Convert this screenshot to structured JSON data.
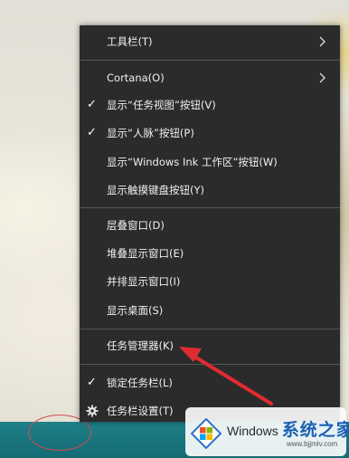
{
  "menu": {
    "items": [
      {
        "label": "工具栏(T)",
        "checked": false,
        "submenu": true
      },
      {
        "label": "Cortana(O)",
        "checked": false,
        "submenu": true
      },
      {
        "label": "显示“任务视图”按钮(V)",
        "checked": true,
        "submenu": false
      },
      {
        "label": "显示“人脉”按钮(P)",
        "checked": true,
        "submenu": false
      },
      {
        "label": "显示“Windows Ink 工作区”按钮(W)",
        "checked": false,
        "submenu": false
      },
      {
        "label": "显示触摸键盘按钮(Y)",
        "checked": false,
        "submenu": false
      },
      {
        "label": "层叠窗口(D)",
        "checked": false,
        "submenu": false
      },
      {
        "label": "堆叠显示窗口(E)",
        "checked": false,
        "submenu": false
      },
      {
        "label": "并排显示窗口(I)",
        "checked": false,
        "submenu": false
      },
      {
        "label": "显示桌面(S)",
        "checked": false,
        "submenu": false
      },
      {
        "label": "任务管理器(K)",
        "checked": false,
        "submenu": false
      },
      {
        "label": "锁定任务栏(L)",
        "checked": true,
        "submenu": false
      },
      {
        "label": "任务栏设置(T)",
        "checked": false,
        "submenu": false,
        "icon": "gear-icon"
      }
    ],
    "check_glyph": "✓"
  },
  "watermark": {
    "brand": "Windows",
    "brand_suffix": "系统之家",
    "url": "www.bjjmlv.com"
  },
  "colors": {
    "menu_bg": "#2b2b2b",
    "menu_text": "#f0f0f0",
    "separator": "#555555",
    "annotation": "#e02b32",
    "taskbar": "#1a7580"
  }
}
